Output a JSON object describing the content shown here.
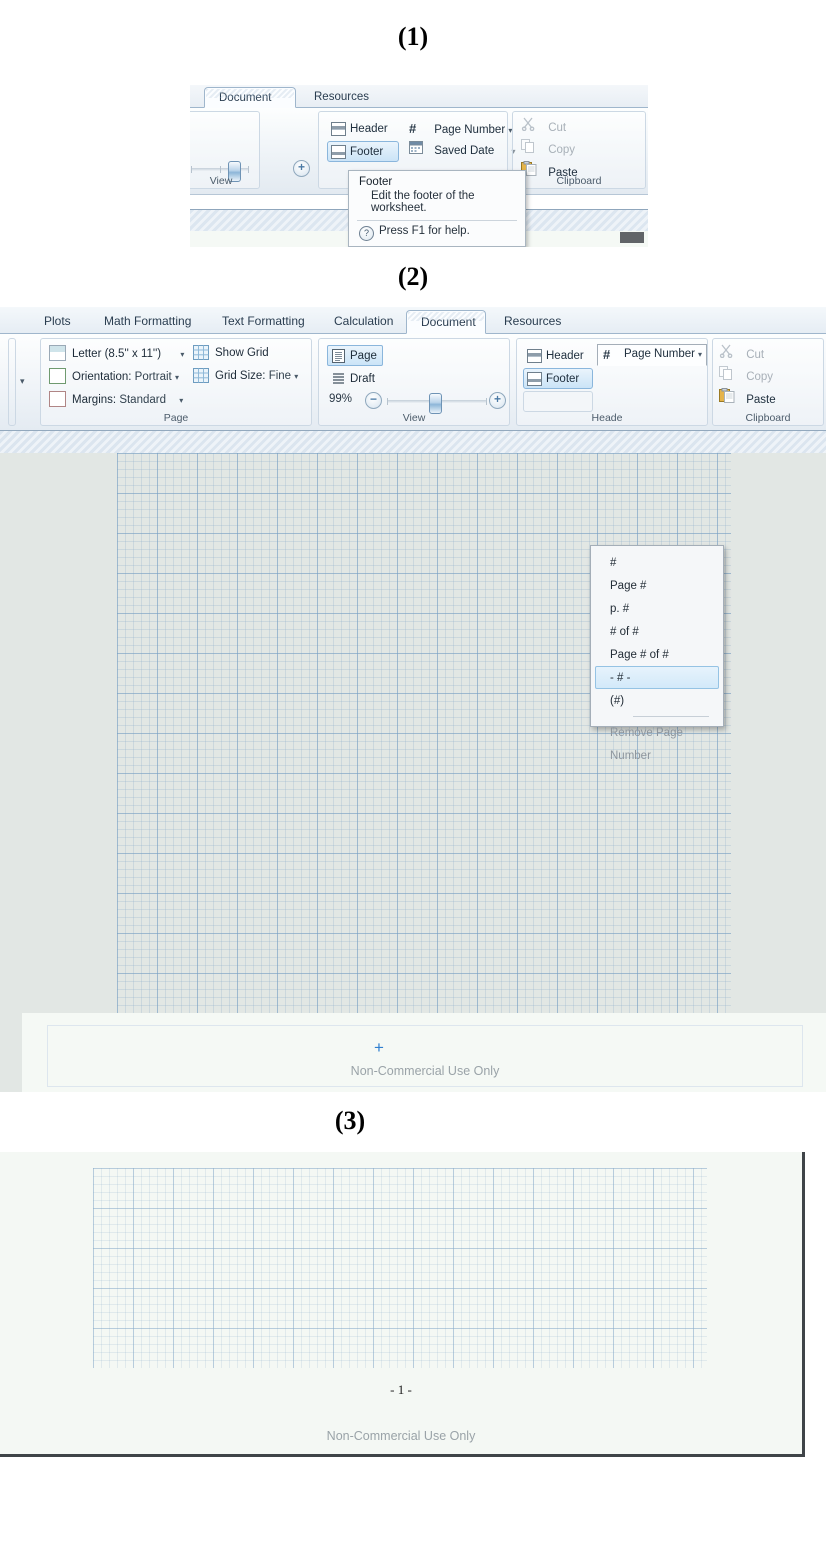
{
  "figure": {
    "captions": [
      "(1)",
      "(2)",
      "(3)"
    ]
  },
  "panel1": {
    "tabs": [
      {
        "label": "Document",
        "active": true
      },
      {
        "label": "Resources",
        "active": false
      }
    ],
    "view_group": {
      "label": "View",
      "zoom_in_label": "+"
    },
    "header_footer_group": {
      "header_label": "Header",
      "footer_label": "Footer",
      "page_number_label": "Page Number",
      "page_number_caret": "▾",
      "saved_date_label": "Saved Date",
      "saved_date_caret": "▾"
    },
    "clipboard_group": {
      "label": "Clipboard",
      "cut_label": "Cut",
      "copy_label": "Copy",
      "paste_label": "Paste"
    },
    "tooltip": {
      "title": "Footer",
      "body": "Edit the footer of the worksheet.",
      "help": "Press F1 for help.",
      "help_icon": "?"
    }
  },
  "panel2": {
    "tabs": [
      {
        "label": "Plots",
        "active": false
      },
      {
        "label": "Math Formatting",
        "active": false
      },
      {
        "label": "Text Formatting",
        "active": false
      },
      {
        "label": "Calculation",
        "active": false
      },
      {
        "label": "Document",
        "active": true
      },
      {
        "label": "Resources",
        "active": false
      }
    ],
    "page_group": {
      "label": "Page",
      "paper_size": "Letter (8.5'' x 11'')",
      "paper_size_caret": "▾",
      "orientation_label": "Orientation:",
      "orientation_value": "Portrait",
      "orientation_caret": "▾",
      "margins_label": "Margins:",
      "margins_value": "Standard",
      "margins_caret": "▾",
      "show_grid_label": "Show Grid",
      "grid_size_label": "Grid Size:",
      "grid_size_value": "Fine",
      "grid_size_caret": "▾"
    },
    "view_group": {
      "label": "View",
      "page_label": "Page",
      "draft_label": "Draft",
      "zoom_value": "99%",
      "zoom_out_label": "−",
      "zoom_in_label": "+"
    },
    "header_footer_group": {
      "label": "Heade",
      "header_label": "Header",
      "footer_label": "Footer",
      "page_number_label": "Page Number",
      "page_number_caret": "▾"
    },
    "clipboard_group": {
      "label": "Clipboard",
      "cut_label": "Cut",
      "copy_label": "Copy",
      "paste_label": "Paste"
    },
    "page_number_menu": {
      "items": [
        {
          "label": "#",
          "selected": false,
          "disabled": false
        },
        {
          "label": "Page #",
          "selected": false,
          "disabled": false
        },
        {
          "label": "p. #",
          "selected": false,
          "disabled": false
        },
        {
          "label": "# of #",
          "selected": false,
          "disabled": false
        },
        {
          "label": "Page # of #",
          "selected": false,
          "disabled": false
        },
        {
          "label": "- # -",
          "selected": true,
          "disabled": false
        },
        {
          "label": "(#)",
          "selected": false,
          "disabled": false
        }
      ],
      "remove_label": "Remove Page Number"
    },
    "worksheet": {
      "footer_plus": "+",
      "watermark": "Non-Commercial Use Only"
    }
  },
  "panel3": {
    "page_number": "- 1 -",
    "watermark": "Non-Commercial Use Only"
  },
  "colors": {
    "accent": "#2f7fd0",
    "selection": "#cbe4f7",
    "tab_border": "#9fb6cc",
    "grid_line": "#96b4cd",
    "watermark": "#9aa3a8"
  }
}
